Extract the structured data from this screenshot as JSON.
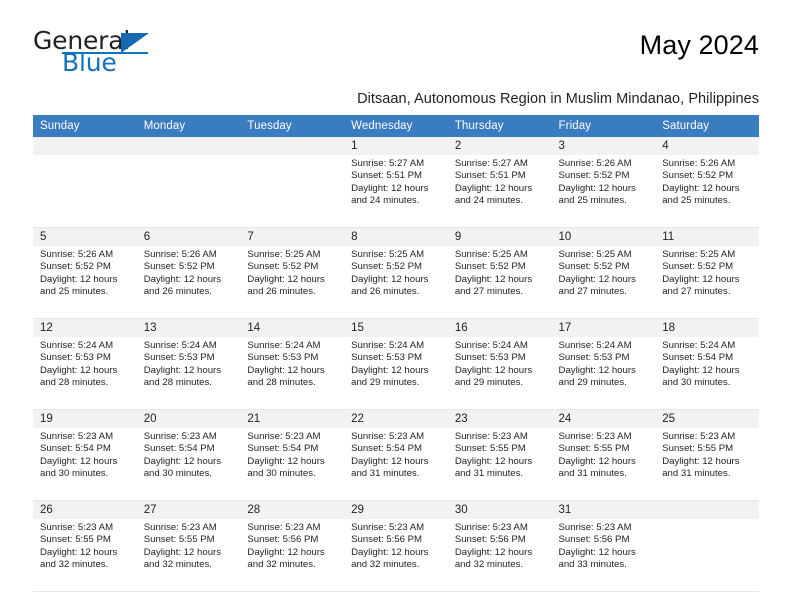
{
  "brand": {
    "name_part1": "General",
    "name_part2": "Blue"
  },
  "header": {
    "title": "May 2024",
    "subtitle": "Ditsaan, Autonomous Region in Muslim Mindanao, Philippines"
  },
  "colors": {
    "header_blue": "#3a7cc0",
    "brand_blue": "#1275bc",
    "daynum_bg": "#f2f2f2",
    "text": "#231f20"
  },
  "calendar": {
    "weekdays": [
      "Sunday",
      "Monday",
      "Tuesday",
      "Wednesday",
      "Thursday",
      "Friday",
      "Saturday"
    ],
    "weeks": [
      [
        {
          "empty": true
        },
        {
          "empty": true
        },
        {
          "empty": true
        },
        {
          "day": "1",
          "sunrise": "Sunrise: 5:27 AM",
          "sunset": "Sunset: 5:51 PM",
          "daylight": "Daylight: 12 hours and 24 minutes."
        },
        {
          "day": "2",
          "sunrise": "Sunrise: 5:27 AM",
          "sunset": "Sunset: 5:51 PM",
          "daylight": "Daylight: 12 hours and 24 minutes."
        },
        {
          "day": "3",
          "sunrise": "Sunrise: 5:26 AM",
          "sunset": "Sunset: 5:52 PM",
          "daylight": "Daylight: 12 hours and 25 minutes."
        },
        {
          "day": "4",
          "sunrise": "Sunrise: 5:26 AM",
          "sunset": "Sunset: 5:52 PM",
          "daylight": "Daylight: 12 hours and 25 minutes."
        }
      ],
      [
        {
          "day": "5",
          "sunrise": "Sunrise: 5:26 AM",
          "sunset": "Sunset: 5:52 PM",
          "daylight": "Daylight: 12 hours and 25 minutes."
        },
        {
          "day": "6",
          "sunrise": "Sunrise: 5:26 AM",
          "sunset": "Sunset: 5:52 PM",
          "daylight": "Daylight: 12 hours and 26 minutes."
        },
        {
          "day": "7",
          "sunrise": "Sunrise: 5:25 AM",
          "sunset": "Sunset: 5:52 PM",
          "daylight": "Daylight: 12 hours and 26 minutes."
        },
        {
          "day": "8",
          "sunrise": "Sunrise: 5:25 AM",
          "sunset": "Sunset: 5:52 PM",
          "daylight": "Daylight: 12 hours and 26 minutes."
        },
        {
          "day": "9",
          "sunrise": "Sunrise: 5:25 AM",
          "sunset": "Sunset: 5:52 PM",
          "daylight": "Daylight: 12 hours and 27 minutes."
        },
        {
          "day": "10",
          "sunrise": "Sunrise: 5:25 AM",
          "sunset": "Sunset: 5:52 PM",
          "daylight": "Daylight: 12 hours and 27 minutes."
        },
        {
          "day": "11",
          "sunrise": "Sunrise: 5:25 AM",
          "sunset": "Sunset: 5:52 PM",
          "daylight": "Daylight: 12 hours and 27 minutes."
        }
      ],
      [
        {
          "day": "12",
          "sunrise": "Sunrise: 5:24 AM",
          "sunset": "Sunset: 5:53 PM",
          "daylight": "Daylight: 12 hours and 28 minutes."
        },
        {
          "day": "13",
          "sunrise": "Sunrise: 5:24 AM",
          "sunset": "Sunset: 5:53 PM",
          "daylight": "Daylight: 12 hours and 28 minutes."
        },
        {
          "day": "14",
          "sunrise": "Sunrise: 5:24 AM",
          "sunset": "Sunset: 5:53 PM",
          "daylight": "Daylight: 12 hours and 28 minutes."
        },
        {
          "day": "15",
          "sunrise": "Sunrise: 5:24 AM",
          "sunset": "Sunset: 5:53 PM",
          "daylight": "Daylight: 12 hours and 29 minutes."
        },
        {
          "day": "16",
          "sunrise": "Sunrise: 5:24 AM",
          "sunset": "Sunset: 5:53 PM",
          "daylight": "Daylight: 12 hours and 29 minutes."
        },
        {
          "day": "17",
          "sunrise": "Sunrise: 5:24 AM",
          "sunset": "Sunset: 5:53 PM",
          "daylight": "Daylight: 12 hours and 29 minutes."
        },
        {
          "day": "18",
          "sunrise": "Sunrise: 5:24 AM",
          "sunset": "Sunset: 5:54 PM",
          "daylight": "Daylight: 12 hours and 30 minutes."
        }
      ],
      [
        {
          "day": "19",
          "sunrise": "Sunrise: 5:23 AM",
          "sunset": "Sunset: 5:54 PM",
          "daylight": "Daylight: 12 hours and 30 minutes."
        },
        {
          "day": "20",
          "sunrise": "Sunrise: 5:23 AM",
          "sunset": "Sunset: 5:54 PM",
          "daylight": "Daylight: 12 hours and 30 minutes."
        },
        {
          "day": "21",
          "sunrise": "Sunrise: 5:23 AM",
          "sunset": "Sunset: 5:54 PM",
          "daylight": "Daylight: 12 hours and 30 minutes."
        },
        {
          "day": "22",
          "sunrise": "Sunrise: 5:23 AM",
          "sunset": "Sunset: 5:54 PM",
          "daylight": "Daylight: 12 hours and 31 minutes."
        },
        {
          "day": "23",
          "sunrise": "Sunrise: 5:23 AM",
          "sunset": "Sunset: 5:55 PM",
          "daylight": "Daylight: 12 hours and 31 minutes."
        },
        {
          "day": "24",
          "sunrise": "Sunrise: 5:23 AM",
          "sunset": "Sunset: 5:55 PM",
          "daylight": "Daylight: 12 hours and 31 minutes."
        },
        {
          "day": "25",
          "sunrise": "Sunrise: 5:23 AM",
          "sunset": "Sunset: 5:55 PM",
          "daylight": "Daylight: 12 hours and 31 minutes."
        }
      ],
      [
        {
          "day": "26",
          "sunrise": "Sunrise: 5:23 AM",
          "sunset": "Sunset: 5:55 PM",
          "daylight": "Daylight: 12 hours and 32 minutes."
        },
        {
          "day": "27",
          "sunrise": "Sunrise: 5:23 AM",
          "sunset": "Sunset: 5:55 PM",
          "daylight": "Daylight: 12 hours and 32 minutes."
        },
        {
          "day": "28",
          "sunrise": "Sunrise: 5:23 AM",
          "sunset": "Sunset: 5:56 PM",
          "daylight": "Daylight: 12 hours and 32 minutes."
        },
        {
          "day": "29",
          "sunrise": "Sunrise: 5:23 AM",
          "sunset": "Sunset: 5:56 PM",
          "daylight": "Daylight: 12 hours and 32 minutes."
        },
        {
          "day": "30",
          "sunrise": "Sunrise: 5:23 AM",
          "sunset": "Sunset: 5:56 PM",
          "daylight": "Daylight: 12 hours and 32 minutes."
        },
        {
          "day": "31",
          "sunrise": "Sunrise: 5:23 AM",
          "sunset": "Sunset: 5:56 PM",
          "daylight": "Daylight: 12 hours and 33 minutes."
        },
        {
          "empty": true
        }
      ]
    ]
  }
}
